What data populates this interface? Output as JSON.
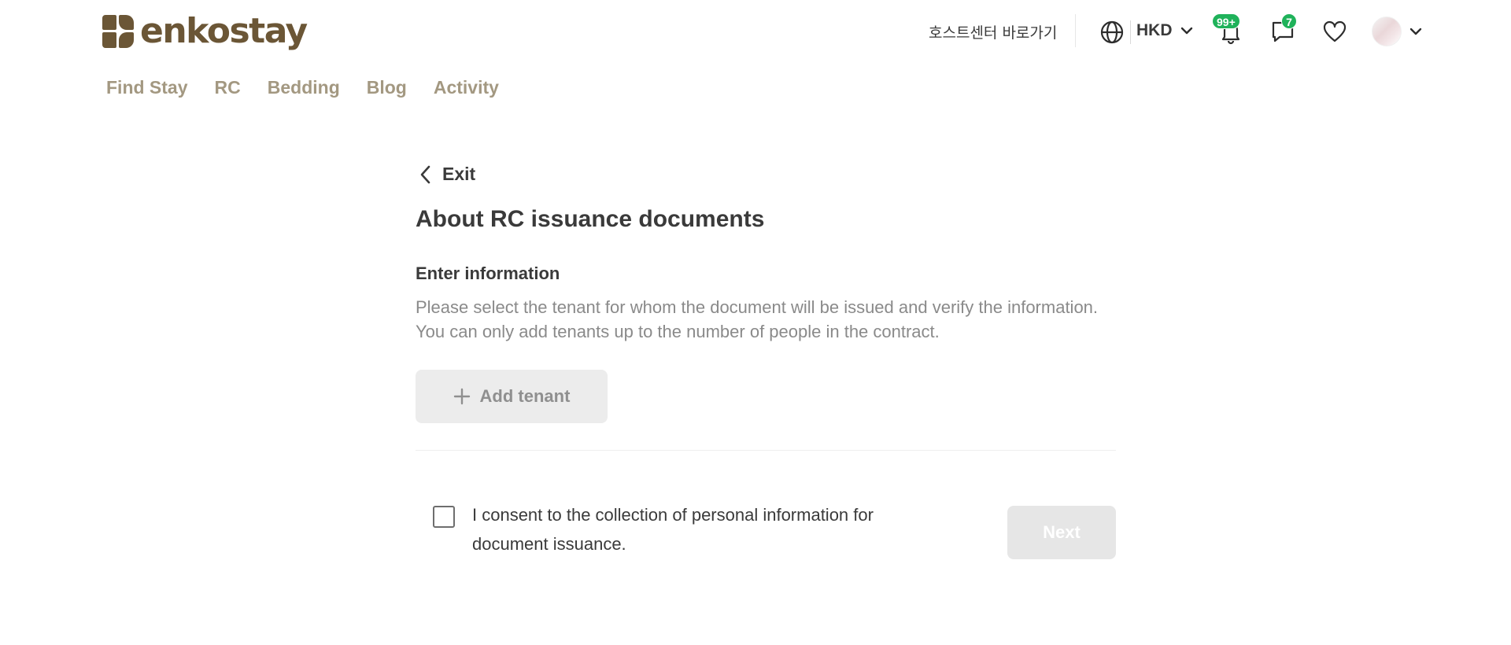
{
  "brand": {
    "name": "enkostay",
    "color": "#6b5636"
  },
  "header": {
    "host_link": "호스트센터 바로가기",
    "currency": "HKD",
    "notifications_badge": "99+",
    "messages_badge": "7",
    "badge_color": "#1fb25a"
  },
  "nav": {
    "items": [
      "Find Stay",
      "RC",
      "Bedding",
      "Blog",
      "Activity"
    ],
    "color": "#a39881"
  },
  "main": {
    "exit_label": "Exit",
    "title": "About RC issuance documents",
    "section_label": "Enter information",
    "description_line1": "Please select the tenant for whom the document will be issued and verify the information.",
    "description_line2": "You can only add tenants up to the number of people in the contract.",
    "add_tenant_label": "Add tenant",
    "consent_text": "I consent to the collection of personal information for document issuance.",
    "next_label": "Next"
  }
}
